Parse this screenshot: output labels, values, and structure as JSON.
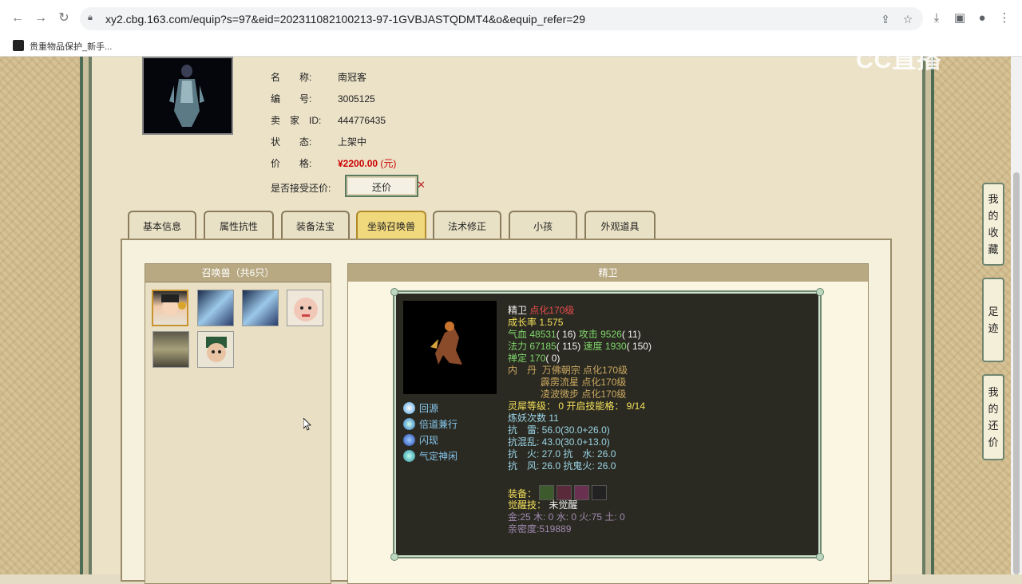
{
  "browser": {
    "url": "xy2.cbg.163.com/equip?s=97&eid=202311082100213-97-1GVBJASTQDMT4&o&equip_refer=29",
    "bookmark_label": "贵重物品保护_新手..."
  },
  "watermark": "CC直播",
  "product": {
    "name_label": "名　　称:",
    "name_value": "南冠客",
    "number_label": "编　　号:",
    "number_value": "3005125",
    "seller_label": "卖　家　ID:",
    "seller_value": "444776435",
    "status_label": "状　　态:",
    "status_value": "上架中",
    "price_label": "价　　格:",
    "price_value": "¥2200.00",
    "price_unit": "(元)",
    "bargain_label": "是否接受还价:",
    "bargain_button": "还价"
  },
  "tabs": [
    {
      "label": "基本信息"
    },
    {
      "label": "属性抗性"
    },
    {
      "label": "装备法宝"
    },
    {
      "label": "坐骑召唤兽"
    },
    {
      "label": "法术修正"
    },
    {
      "label": "小孩"
    },
    {
      "label": "外观道具"
    }
  ],
  "active_tab": "坐骑召唤兽",
  "pet_list": {
    "title": "召唤兽（共6只）"
  },
  "pet_detail": {
    "title": "精卫",
    "name": "精卫",
    "level_tag": "点化170级",
    "growth": "成长率 1.575",
    "hp_label": "气血",
    "hp": "48531",
    "hp_rank": "( 16)",
    "atk_label": "攻击",
    "atk": "9526",
    "atk_rank": "( 11)",
    "mp_label": "法力",
    "mp": "67185",
    "mp_rank": "( 115)",
    "spd_label": "速度",
    "spd": "1930",
    "spd_rank": "( 150)",
    "focus_label": "禅定",
    "focus": "170",
    "focus_rank": "( 0)",
    "neidan_label": "内　丹",
    "neidan": [
      {
        "name": "万佛朝宗",
        "level": "点化170级"
      },
      {
        "name": "霹雳流星",
        "level": "点化170级"
      },
      {
        "name": "凌波微步",
        "level": "点化170级"
      }
    ],
    "spirit_line": "灵犀等级： 0 开启技能格： 9/14",
    "refine_line": "炼妖次数 11",
    "res_lines": [
      "抗　雷: 56.0(30.0+26.0)",
      "抗混乱: 43.0(30.0+13.0)",
      "抗　火: 27.0 抗　水: 26.0",
      "抗　风: 26.0 抗鬼火: 26.0"
    ],
    "equip_label": "装备：",
    "awaken_label": "觉醒技：",
    "awaken_value": "未觉醒",
    "elements": "金:25 木: 0 水: 0 火:75 土: 0",
    "intimacy": "亲密度:519889",
    "skills": [
      {
        "label": "回源"
      },
      {
        "label": "倍道兼行"
      },
      {
        "label": "闪现"
      },
      {
        "label": "气定神闲"
      }
    ]
  },
  "side_buttons": [
    {
      "label": [
        "我",
        "的",
        "收",
        "藏"
      ]
    },
    {
      "label": [
        "足",
        "迹"
      ]
    },
    {
      "label": [
        "我",
        "的",
        "还",
        "价"
      ]
    }
  ],
  "colors": {
    "frame_green": "#4e6b56",
    "tab_active": "#f0d87d",
    "price_red": "#cc0000",
    "card_bg": "#2b2a22"
  }
}
